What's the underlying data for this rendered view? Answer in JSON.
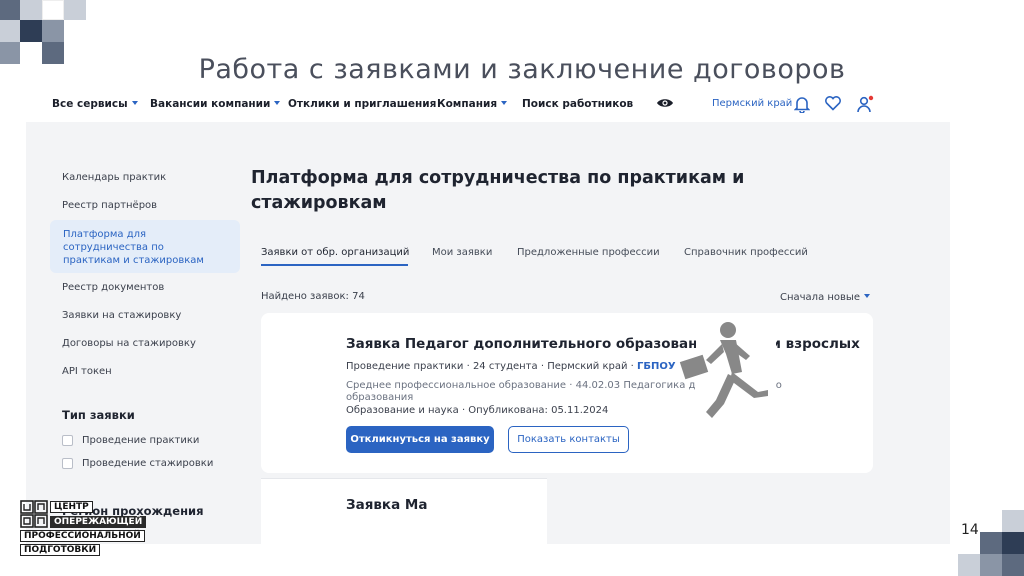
{
  "slide": {
    "title": "Работа с заявками и заключение договоров",
    "page_number": "14"
  },
  "topnav": {
    "items": [
      {
        "label": "Все сервисы",
        "dropdown": true
      },
      {
        "label": "Вакансии компании",
        "dropdown": true
      },
      {
        "label": "Отклики и приглашения",
        "dropdown": false
      },
      {
        "label": "Компания",
        "dropdown": true
      },
      {
        "label": "Поиск работников",
        "dropdown": false
      }
    ],
    "region": "Пермский край",
    "icons": [
      "eye-icon",
      "bell-icon",
      "heart-icon",
      "user-icon"
    ]
  },
  "sidebar": {
    "items": [
      {
        "label": "Календарь практик"
      },
      {
        "label": "Реестр партнёров"
      },
      {
        "label": "Платформа для сотрудничества по практикам и стажировкам",
        "active": true
      },
      {
        "label": "Реестр документов"
      },
      {
        "label": "Заявки на стажировку"
      },
      {
        "label": "Договоры на стажировку"
      },
      {
        "label": "API токен"
      }
    ],
    "filter_heading": "Тип заявки",
    "filters": [
      {
        "label": "Проведение практики",
        "checked": false
      },
      {
        "label": "Проведение стажировки",
        "checked": false
      }
    ],
    "filter_heading2": "Регион прохождения"
  },
  "main": {
    "title": "Платформа для сотрудничества по практикам и стажировкам",
    "tabs": [
      {
        "label": "Заявки от обр. организаций",
        "active": true
      },
      {
        "label": "Мои заявки"
      },
      {
        "label": "Предложенные профессии"
      },
      {
        "label": "Справочник профессий"
      }
    ],
    "found": "Найдено заявок: 74",
    "sort": "Сначала новые",
    "cards": [
      {
        "title": "Заявка Педагог дополнительного образования детей и взрослых",
        "meta_type": "Проведение практики",
        "meta_students": "24 студента",
        "meta_region": "Пермский край",
        "meta_org": "ГБПОУ",
        "desc": "Среднее профессиональное образование · 44.02.03 Педагогика дополнительного образования",
        "sphere": "Образование и наука · Опубликована: 05.11.2024",
        "respond_label": "Откликнуться на заявку",
        "contacts_label": "Показать контакты"
      },
      {
        "title": "Заявка Ма"
      }
    ]
  },
  "logo": {
    "line1": "ЦЕНТР",
    "line2": "ОПЕРЕЖАЮЩЕЙ",
    "line3": "ПРОФЕССИОНАЛЬНОЙ",
    "line4": "ПОДГОТОВКИ"
  },
  "colors": {
    "accent": "#2b64c2",
    "sidebar_bg": "#f3f4f6",
    "active_bg": "#e4edf9",
    "deco_dark": "#5d6a7f",
    "deco_light": "#c9cfd8"
  }
}
